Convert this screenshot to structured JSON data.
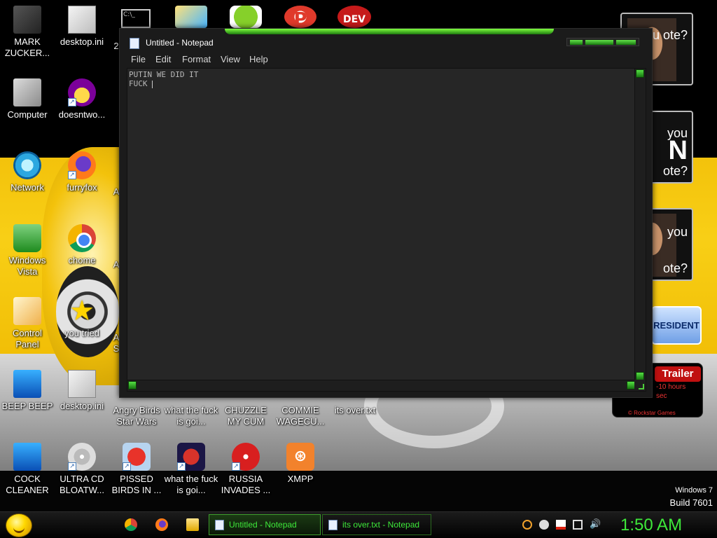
{
  "desktop": {
    "icons": [
      {
        "label": "MARK ZUCKER...",
        "icon": "folder-icon"
      },
      {
        "label": "desktop.ini",
        "icon": "settings-file-icon"
      },
      {
        "label": "2",
        "icon": "command-prompt-icon"
      },
      {
        "label": "Computer",
        "icon": "computer-icon"
      },
      {
        "label": "doesntwo...",
        "icon": "yahoo-messenger-icon"
      },
      {
        "label": "Network",
        "icon": "network-icon"
      },
      {
        "label": "furryfox",
        "icon": "firefox-icon"
      },
      {
        "label": "A",
        "icon": "app-icon"
      },
      {
        "label": "Windows Vista",
        "icon": "recycle-bin-icon"
      },
      {
        "label": "chome",
        "icon": "chrome-icon"
      },
      {
        "label": "A",
        "icon": "app-icon"
      },
      {
        "label": "Control Panel",
        "icon": "control-panel-icon"
      },
      {
        "label": "you tried",
        "icon": "star-icon"
      },
      {
        "label": "A S",
        "icon": "app-icon"
      },
      {
        "label": "BEEP BEEP",
        "icon": "blue-app-icon"
      },
      {
        "label": "desktop.ini",
        "icon": "settings-file-icon"
      },
      {
        "label": "Angry Birds Star Wars",
        "icon": "angry-birds-icon"
      },
      {
        "label": "what the fuck is goi...",
        "icon": "document-icon"
      },
      {
        "label": "CHUZZLE MY CUM",
        "icon": "document-icon"
      },
      {
        "label": "COMMIE WAGECU...",
        "icon": "document-icon"
      },
      {
        "label": "its over.txt",
        "icon": "text-file-icon"
      },
      {
        "label": "COCK CLEANER",
        "icon": "blue-app-icon"
      },
      {
        "label": "ULTRA CD BLOATW...",
        "icon": "cd-icon"
      },
      {
        "label": "PISSED BIRDS IN ...",
        "icon": "angry-birds-icon"
      },
      {
        "label": "what the fuck is goi...",
        "icon": "angry-birds-space-icon"
      },
      {
        "label": "RUSSIA INVADES ...",
        "icon": "radiation-icon"
      },
      {
        "label": "XMPP",
        "icon": "xampp-icon"
      }
    ],
    "top_row_extras": {
      "dev_label": "DEV",
      "p_label": "P"
    },
    "gadgets": {
      "vote1": "you ote?",
      "vote2_big": "N",
      "vote2_small": "you",
      "vote2_bottom": "ote?",
      "vote3_small": "you",
      "vote3_bottom": "ote?",
      "president": "RESIDENT",
      "trailer_title": "Trailer",
      "trailer_line1": "-10 hours",
      "trailer_line2": "sec",
      "trailer_brand": "© Rockstar Games"
    },
    "windows_version": {
      "line1": "Windows 7",
      "line2": "Build 7601"
    }
  },
  "notepad": {
    "title": "Untitled - Notepad",
    "menu": [
      "File",
      "Edit",
      "Format",
      "View",
      "Help"
    ],
    "content_line1": "PUTIN WE DID IT",
    "content_line2": "FUCK "
  },
  "taskbar": {
    "buttons": [
      {
        "label": "Untitled - Notepad",
        "active": true
      },
      {
        "label": "its over.txt - Notepad",
        "active": false
      }
    ],
    "clock": "1:50 AM",
    "accent": "#3ee83a"
  }
}
